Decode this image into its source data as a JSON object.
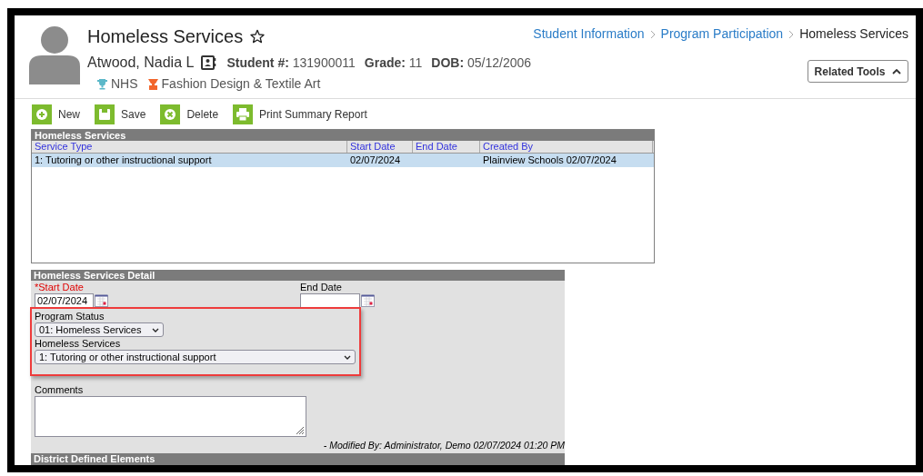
{
  "header": {
    "title": "Homeless Services",
    "favorite": false,
    "breadcrumb": [
      {
        "label": "Student Information",
        "link": true
      },
      {
        "label": "Program Participation",
        "link": true
      },
      {
        "label": "Homeless Services",
        "link": false
      }
    ],
    "student": {
      "name": "Atwood, Nadia L",
      "fields": [
        {
          "label": "Student #:",
          "value": "131900011"
        },
        {
          "label": "Grade:",
          "value": "11"
        },
        {
          "label": "DOB:",
          "value": "05/12/2006"
        }
      ]
    },
    "tags": [
      {
        "kind": "trophy",
        "label": "NHS"
      },
      {
        "kind": "pathway",
        "label": "Fashion Design & Textile Art"
      }
    ],
    "related_tools": {
      "label": "Related Tools",
      "expanded": true
    }
  },
  "toolbar": [
    {
      "kind": "new",
      "label": "New"
    },
    {
      "kind": "save",
      "label": "Save"
    },
    {
      "kind": "delete",
      "label": "Delete"
    },
    {
      "kind": "print",
      "label": "Print Summary Report"
    }
  ],
  "services_table": {
    "title": "Homeless Services",
    "columns": [
      "Service Type",
      "Start Date",
      "End Date",
      "Created By"
    ],
    "rows": [
      {
        "cells": [
          "1: Tutoring or other instructional support",
          "02/07/2024",
          "",
          "Plainview Schools 02/07/2024"
        ],
        "selected": true
      }
    ]
  },
  "detail": {
    "title": "Homeless Services Detail",
    "start_date": {
      "label": "*Start Date",
      "value": "02/07/2024",
      "required": true
    },
    "end_date": {
      "label": "End Date",
      "required": false
    },
    "program_status": {
      "label": "Program Status",
      "value": "01: Homeless Services"
    },
    "homeless_services": {
      "label": "Homeless Services",
      "value": "1: Tutoring or other instructional support"
    },
    "comments": {
      "label": "Comments"
    },
    "modified": "- Modified By: Administrator, Demo 02/07/2024 01:20 PM",
    "next_section": "District Defined Elements"
  }
}
